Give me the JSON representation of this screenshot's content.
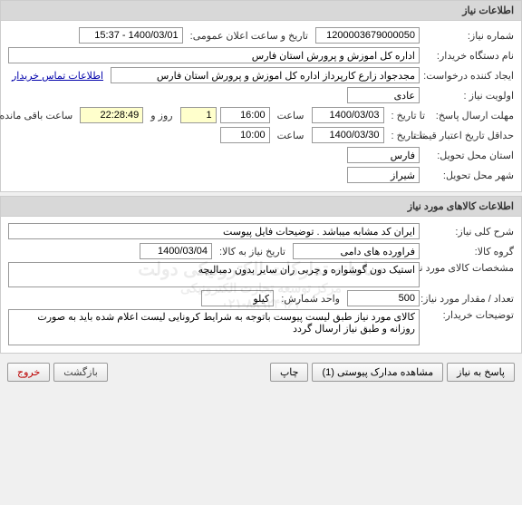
{
  "section1": {
    "title": "اطلاعات نیاز",
    "need_no_label": "شماره نیاز:",
    "need_no": "1200003679000050",
    "pub_date_label": "تاریخ و ساعت اعلان عمومی:",
    "pub_date": "1400/03/01 - 15:37",
    "buyer_label": "نام دستگاه خریدار:",
    "buyer": "اداره کل اموزش و پرورش استان فارس",
    "creator_label": "ایجاد کننده درخواست:",
    "creator": "مجدجواد زارع کارپرداز اداره کل اموزش و پرورش استان فارس",
    "priority_label": "اولویت نیاز :",
    "priority": "عادی",
    "reply_deadline_label": "مهلت ارسال پاسخ:",
    "to_date_label": "تا تاریخ :",
    "reply_date": "1400/03/03",
    "time_label": "ساعت",
    "reply_time": "16:00",
    "day_label": "روز و",
    "days_left": "1",
    "time_left": "22:28:49",
    "time_left_label": "ساعت باقی مانده",
    "contact_link": "اطلاعات تماس خریدار",
    "validity_label": "حداقل تاریخ اعتبار قیمت:",
    "validity_to_label": "تا تاریخ :",
    "validity_date": "1400/03/30",
    "validity_time": "10:00",
    "province_label": "استان محل تحویل:",
    "province": "فارس",
    "city_label": "شهر محل تحویل:",
    "city": "شیراز"
  },
  "section2": {
    "title": "اطلاعات کالاهای مورد نیاز",
    "desc_label": "شرح کلی نیاز:",
    "desc": "ایران کد مشابه میباشد . توضیحات فایل پیوست",
    "group_label": "گروه کالا:",
    "group": "فراورده های دامی",
    "need_to_label": "تاریخ نیاز به کالا:",
    "need_to_date": "1400/03/04",
    "spec_label": "مشخصات کالای مورد نیاز:",
    "spec": "استیک دون گوشواره و چربی ران سایر بدون دمبالیچه",
    "qty_label": "تعداد / مقدار مورد نیاز:",
    "qty": "500",
    "unit_label": "واحد شمارش:",
    "unit": "کیلو",
    "buyer_notes_label": "توضیحات خریدار:",
    "buyer_notes": "کالای مورد نیاز طبق لیست پیوست باتوجه به شرایط کرونایی لیست اعلام شده باید به صورت روزانه و طبق نیاز ارسال گردد"
  },
  "watermark": {
    "line1": "سامانه تدارکات الکترونیکی دولت",
    "line2": "مرکز توسعه تجارت الکترونیکی",
    "phone": "۰۲۱-۸۸۹۲۴۹۶۷"
  },
  "buttons": {
    "reply": "پاسخ به نیاز",
    "attach": "مشاهده مدارک پیوستی (1)",
    "print": "چاپ",
    "back": "بازگشت",
    "exit": "خروج"
  }
}
